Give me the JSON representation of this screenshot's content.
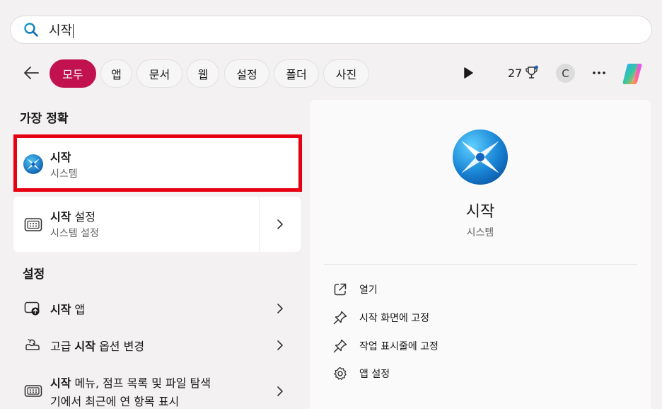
{
  "search": {
    "query": "시작"
  },
  "filters": {
    "chips": [
      "모두",
      "앱",
      "문서",
      "웹",
      "설정",
      "폴더",
      "사진"
    ],
    "active_index": 0,
    "points": "27",
    "avatar_letter": "C"
  },
  "best_match": {
    "heading": "가장 정확",
    "item": {
      "title": "시작",
      "subtitle": "시스템"
    }
  },
  "second_result": {
    "title_bold": "시작",
    "title_rest": " 설정",
    "subtitle": "시스템 설정"
  },
  "settings": {
    "heading": "설정",
    "items": [
      {
        "bold": "시작",
        "rest": " 앱"
      },
      {
        "pre": "고급 ",
        "bold": "시작",
        "rest": " 옵션 변경"
      },
      {
        "bold": "시작",
        "rest": " 메뉴, 점프 목록 및 파일 탐색",
        "line2": "기에서 최근에 연 항목 표시"
      }
    ]
  },
  "preview": {
    "title": "시작",
    "subtitle": "시스템",
    "actions": [
      "열기",
      "시작 화면에 고정",
      "작업 표시줄에 고정",
      "앱 설정"
    ]
  },
  "colors": {
    "accent": "#c1124f",
    "highlight_border": "#e60012"
  }
}
